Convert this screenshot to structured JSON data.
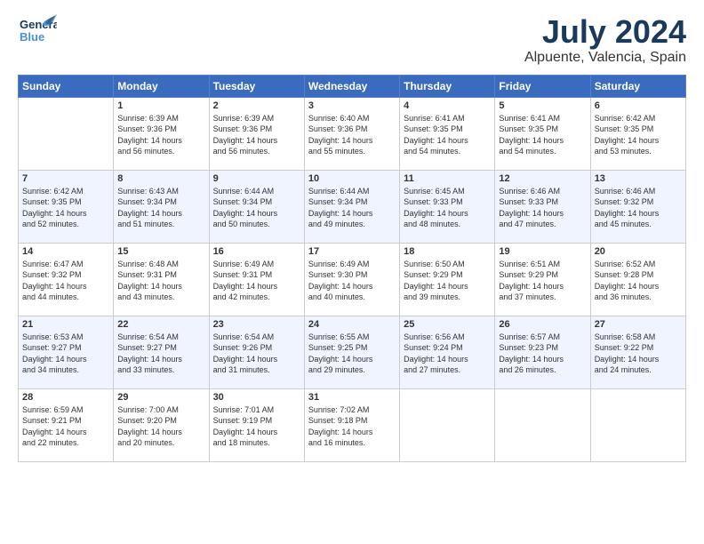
{
  "header": {
    "logo_general": "General",
    "logo_blue": "Blue",
    "title": "July 2024",
    "location": "Alpuente, Valencia, Spain"
  },
  "weekdays": [
    "Sunday",
    "Monday",
    "Tuesday",
    "Wednesday",
    "Thursday",
    "Friday",
    "Saturday"
  ],
  "weeks": [
    [
      {
        "day": "",
        "info": ""
      },
      {
        "day": "1",
        "info": "Sunrise: 6:39 AM\nSunset: 9:36 PM\nDaylight: 14 hours\nand 56 minutes."
      },
      {
        "day": "2",
        "info": "Sunrise: 6:39 AM\nSunset: 9:36 PM\nDaylight: 14 hours\nand 56 minutes."
      },
      {
        "day": "3",
        "info": "Sunrise: 6:40 AM\nSunset: 9:36 PM\nDaylight: 14 hours\nand 55 minutes."
      },
      {
        "day": "4",
        "info": "Sunrise: 6:41 AM\nSunset: 9:35 PM\nDaylight: 14 hours\nand 54 minutes."
      },
      {
        "day": "5",
        "info": "Sunrise: 6:41 AM\nSunset: 9:35 PM\nDaylight: 14 hours\nand 54 minutes."
      },
      {
        "day": "6",
        "info": "Sunrise: 6:42 AM\nSunset: 9:35 PM\nDaylight: 14 hours\nand 53 minutes."
      }
    ],
    [
      {
        "day": "7",
        "info": "Sunrise: 6:42 AM\nSunset: 9:35 PM\nDaylight: 14 hours\nand 52 minutes."
      },
      {
        "day": "8",
        "info": "Sunrise: 6:43 AM\nSunset: 9:34 PM\nDaylight: 14 hours\nand 51 minutes."
      },
      {
        "day": "9",
        "info": "Sunrise: 6:44 AM\nSunset: 9:34 PM\nDaylight: 14 hours\nand 50 minutes."
      },
      {
        "day": "10",
        "info": "Sunrise: 6:44 AM\nSunset: 9:34 PM\nDaylight: 14 hours\nand 49 minutes."
      },
      {
        "day": "11",
        "info": "Sunrise: 6:45 AM\nSunset: 9:33 PM\nDaylight: 14 hours\nand 48 minutes."
      },
      {
        "day": "12",
        "info": "Sunrise: 6:46 AM\nSunset: 9:33 PM\nDaylight: 14 hours\nand 47 minutes."
      },
      {
        "day": "13",
        "info": "Sunrise: 6:46 AM\nSunset: 9:32 PM\nDaylight: 14 hours\nand 45 minutes."
      }
    ],
    [
      {
        "day": "14",
        "info": "Sunrise: 6:47 AM\nSunset: 9:32 PM\nDaylight: 14 hours\nand 44 minutes."
      },
      {
        "day": "15",
        "info": "Sunrise: 6:48 AM\nSunset: 9:31 PM\nDaylight: 14 hours\nand 43 minutes."
      },
      {
        "day": "16",
        "info": "Sunrise: 6:49 AM\nSunset: 9:31 PM\nDaylight: 14 hours\nand 42 minutes."
      },
      {
        "day": "17",
        "info": "Sunrise: 6:49 AM\nSunset: 9:30 PM\nDaylight: 14 hours\nand 40 minutes."
      },
      {
        "day": "18",
        "info": "Sunrise: 6:50 AM\nSunset: 9:29 PM\nDaylight: 14 hours\nand 39 minutes."
      },
      {
        "day": "19",
        "info": "Sunrise: 6:51 AM\nSunset: 9:29 PM\nDaylight: 14 hours\nand 37 minutes."
      },
      {
        "day": "20",
        "info": "Sunrise: 6:52 AM\nSunset: 9:28 PM\nDaylight: 14 hours\nand 36 minutes."
      }
    ],
    [
      {
        "day": "21",
        "info": "Sunrise: 6:53 AM\nSunset: 9:27 PM\nDaylight: 14 hours\nand 34 minutes."
      },
      {
        "day": "22",
        "info": "Sunrise: 6:54 AM\nSunset: 9:27 PM\nDaylight: 14 hours\nand 33 minutes."
      },
      {
        "day": "23",
        "info": "Sunrise: 6:54 AM\nSunset: 9:26 PM\nDaylight: 14 hours\nand 31 minutes."
      },
      {
        "day": "24",
        "info": "Sunrise: 6:55 AM\nSunset: 9:25 PM\nDaylight: 14 hours\nand 29 minutes."
      },
      {
        "day": "25",
        "info": "Sunrise: 6:56 AM\nSunset: 9:24 PM\nDaylight: 14 hours\nand 27 minutes."
      },
      {
        "day": "26",
        "info": "Sunrise: 6:57 AM\nSunset: 9:23 PM\nDaylight: 14 hours\nand 26 minutes."
      },
      {
        "day": "27",
        "info": "Sunrise: 6:58 AM\nSunset: 9:22 PM\nDaylight: 14 hours\nand 24 minutes."
      }
    ],
    [
      {
        "day": "28",
        "info": "Sunrise: 6:59 AM\nSunset: 9:21 PM\nDaylight: 14 hours\nand 22 minutes."
      },
      {
        "day": "29",
        "info": "Sunrise: 7:00 AM\nSunset: 9:20 PM\nDaylight: 14 hours\nand 20 minutes."
      },
      {
        "day": "30",
        "info": "Sunrise: 7:01 AM\nSunset: 9:19 PM\nDaylight: 14 hours\nand 18 minutes."
      },
      {
        "day": "31",
        "info": "Sunrise: 7:02 AM\nSunset: 9:18 PM\nDaylight: 14 hours\nand 16 minutes."
      },
      {
        "day": "",
        "info": ""
      },
      {
        "day": "",
        "info": ""
      },
      {
        "day": "",
        "info": ""
      }
    ]
  ]
}
